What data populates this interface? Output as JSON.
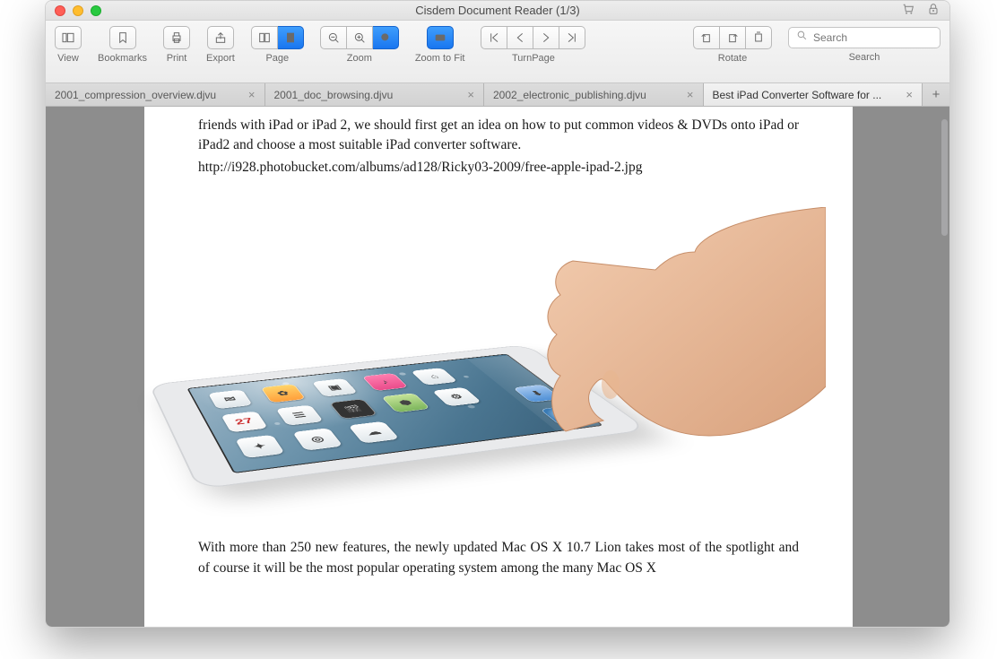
{
  "window": {
    "title": "Cisdem Document Reader (1/3)"
  },
  "toolbar": {
    "view": "View",
    "bookmarks": "Bookmarks",
    "print": "Print",
    "export": "Export",
    "page": "Page",
    "zoom": "Zoom",
    "zoomfit": "Zoom to Fit",
    "turnpage": "TurnPage",
    "rotate": "Rotate",
    "search_label": "Search",
    "search_placeholder": "Search"
  },
  "tabs": [
    {
      "label": "2001_compression_overview.djvu",
      "active": false
    },
    {
      "label": "2001_doc_browsing.djvu",
      "active": false
    },
    {
      "label": "2002_electronic_publishing.djvu",
      "active": false
    },
    {
      "label": "Best iPad Converter Software for ...",
      "active": true
    }
  ],
  "doc": {
    "p1": "friends with iPad or iPad 2, we should first get an idea on how to put common videos & DVDs onto iPad or iPad2 and choose a most suitable iPad converter software.",
    "url": "http://i928.photobucket.com/albums/ad128/Ricky03-2009/free-apple-ipad-2.jpg",
    "cal_day": "27",
    "p2": "With more than 250 new features, the newly updated Mac OS X 10.7 Lion takes most of the spotlight and of course it will be the most popular operating system among the many Mac OS X"
  }
}
